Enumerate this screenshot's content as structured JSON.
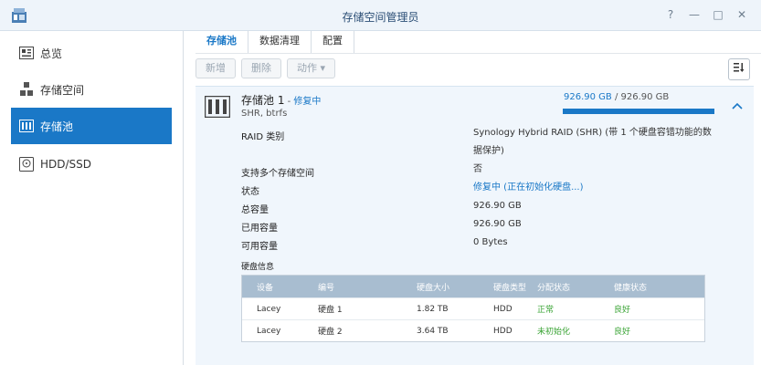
{
  "window": {
    "title": "存储空间管理员",
    "buttons": [
      "?",
      "—",
      "□",
      "✕"
    ]
  },
  "sidebar": {
    "items": [
      {
        "label": "总览",
        "icon": "overview-icon"
      },
      {
        "label": "存储空间",
        "icon": "storage-space-icon"
      },
      {
        "label": "存储池",
        "icon": "storage-pool-icon",
        "active": true
      },
      {
        "label": "HDD/SSD",
        "icon": "hdd-icon"
      }
    ]
  },
  "tabs": [
    {
      "label": "存储池",
      "active": true
    },
    {
      "label": "数据清理"
    },
    {
      "label": "配置"
    }
  ],
  "toolbar": {
    "new_label": "新增",
    "delete_label": "删除",
    "action_label": "动作 ▾",
    "sort_icon": "sort-icon"
  },
  "pool": {
    "name": "存储池 1",
    "status_prefix": " - ",
    "status": "修复中",
    "sub": "SHR, btrfs",
    "used": "926.90 GB",
    "separator": " / ",
    "total": "926.90 GB",
    "usage_fraction": 1.0,
    "properties": [
      {
        "label": "RAID 类别",
        "value": "Synology Hybrid RAID (SHR) (带 1 个硬盘容错功能的数据保护)"
      },
      {
        "label": "支持多个存储空间",
        "value": "否"
      },
      {
        "label": "状态",
        "value": "修复中 (正在初始化硬盘...)",
        "link": true
      },
      {
        "label": "总容量",
        "value": "926.90 GB"
      },
      {
        "label": "已用容量",
        "value": "926.90 GB"
      },
      {
        "label": "可用容量",
        "value": "0 Bytes"
      }
    ]
  },
  "disks": {
    "title": "硬盘信息",
    "headers": [
      "设备",
      "编号",
      "硬盘大小",
      "硬盘类型",
      "分配状态",
      "健康状态"
    ],
    "rows": [
      [
        "Lacey",
        "硬盘 1",
        "1.82 TB",
        "HDD",
        "正常",
        "良好"
      ],
      [
        "Lacey",
        "硬盘 2",
        "3.64 TB",
        "HDD",
        "未初始化",
        "良好"
      ]
    ]
  },
  "colors": {
    "accent": "#1a78c7",
    "good": "#3aa435",
    "table_header": "#a8bdd0"
  }
}
